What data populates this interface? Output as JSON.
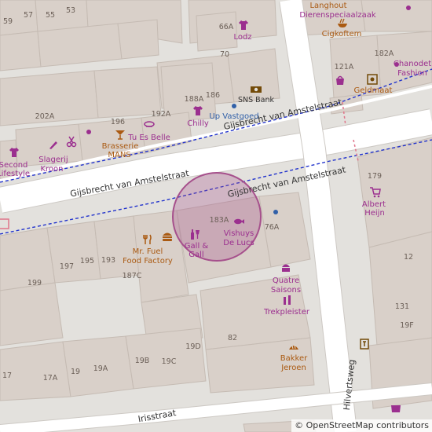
{
  "map": {
    "colors": {
      "background": "#e3e1dd",
      "building": "#d9d0c9",
      "building_stroke": "#c5bbb3",
      "road": "#ffffff",
      "road_casing": "#cdc9c4",
      "bus_route": "#2233cc",
      "rail_dash": "#e0748a",
      "highlight_fill": "#a6508c",
      "poi_purple": "#9b2f8f",
      "poi_brown": "#aa5a12"
    },
    "streets": {
      "gijsbrecht_west": "Gijsbrecht van Amstelstraat",
      "gijsbrecht_center": "Gijsbrecht van Amstelstraat",
      "gijsbrecht_east": "Gijsbrecht van Amstelstraat",
      "hilvertsweg": "Hilvertsweg",
      "irisstraat": "Irisstraat"
    },
    "house_numbers": [
      "59",
      "57",
      "55",
      "53",
      "66A",
      "70",
      "202A",
      "196",
      "192A",
      "188A",
      "186",
      "183A",
      "76A",
      "197",
      "195",
      "193",
      "187C",
      "199",
      "19D",
      "82",
      "19B",
      "19C",
      "17A",
      "19",
      "19A",
      "17",
      "179",
      "12",
      "131",
      "19F",
      "121A",
      "182A"
    ],
    "pois": {
      "langhout": "Langhout",
      "dierenspeciaalzaak": "Dierenspeciaalzaak",
      "lodz": "Lodz",
      "cigkoftem": "Cigkoftem",
      "sns_bank": "SNS Bank",
      "up_vastgoed": "Up Vastgoed",
      "chilly": "Chilly",
      "tu_es_belle": "Tu Es Belle",
      "brasserie": "Brasserie",
      "mans": "MANS",
      "slagerij": "Slagerij",
      "kroon": "Kroon",
      "second": "Second",
      "lifestyle": "Lifestyle",
      "geldmaat": "Geldmaat",
      "chanodet": "Chanodet",
      "fashion": "Fashion",
      "albert": "Albert",
      "heijn": "Heijn",
      "mr_fuel": "Mr. Fuel",
      "food_factory": "Food Factory",
      "gall_1": "Gall &",
      "gall_2": "Gall",
      "vishuys": "Vishuys",
      "de_lucs": "De Lucs",
      "quatre": "Quatre",
      "saisons": "Saisons",
      "trekpleister": "Trekpleister",
      "bakker": "Bakker",
      "jeroen": "Jeroen"
    },
    "icons": [
      "shirt-icon",
      "shop-icon",
      "cocktail-icon",
      "hairdresser-icon",
      "butcher-icon",
      "bank-icon",
      "atm-icon",
      "basket-icon",
      "food-icon",
      "burger-icon",
      "wine-icon",
      "fish-icon",
      "cake-icon",
      "bakery-icon",
      "cart-icon"
    ],
    "highlight": {
      "label": "selected area",
      "shape": "circle"
    },
    "attribution": {
      "copyright_symbol": "©",
      "text": "OpenStreetMap contributors"
    }
  }
}
